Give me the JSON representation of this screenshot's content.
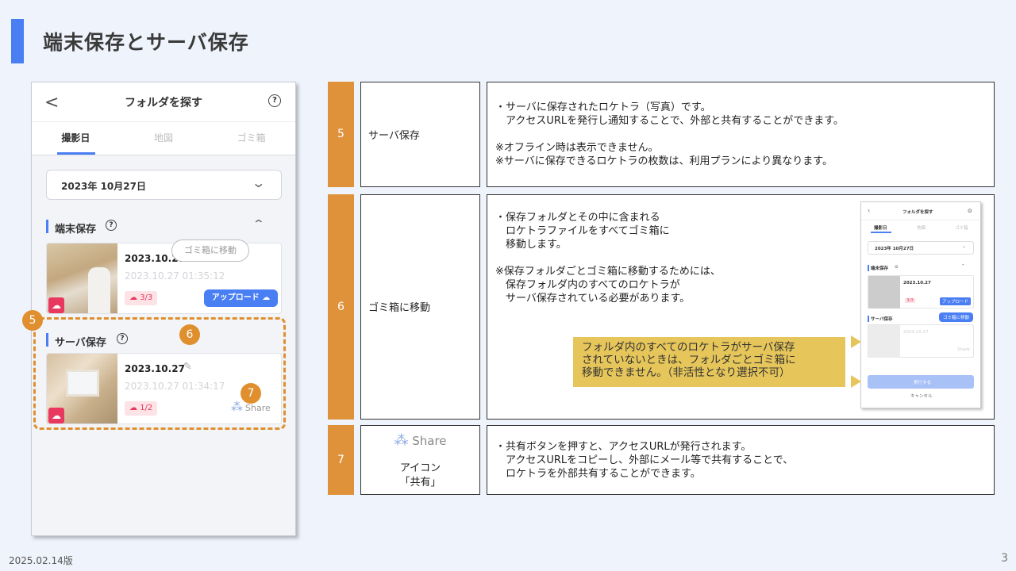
{
  "title": "端末保存とサーバ保存",
  "phone": {
    "back": "<",
    "title": "フォルダを探す",
    "help": "?",
    "tabs": [
      "撮影日",
      "地図",
      "ゴミ箱"
    ],
    "date": "2023年 10月27日",
    "local_section": "端末保存",
    "server_section": "サーバ保存",
    "card1": {
      "date": "2023.10.27",
      "time": "2023.10.27 01:35:12",
      "count": "3/3",
      "upload": "アップロード"
    },
    "card2": {
      "date": "2023.10.27",
      "time": "2023.10.27 01:34:17",
      "count": "1/2",
      "share": "Share"
    },
    "trash_button": "ゴミ箱に移動",
    "badges": [
      "5",
      "6",
      "7"
    ]
  },
  "rows": [
    {
      "num": "5",
      "label": "サーバ保存",
      "desc": "・サーバに保存されたロケトラ（写真）です。\n　アクセスURLを発行し通知することで、外部と共有することができます。\n\n※オフライン時は表示できません。\n※サーバに保存できるロケトラの枚数は、利用プランにより異なります。"
    },
    {
      "num": "6",
      "label": "ゴミ箱に移動",
      "desc": "・保存フォルダとその中に含まれる\n　ロケトラファイルをすべてゴミ箱に\n　移動します。\n\n※保存フォルダごとゴミ箱に移動するためには、\n　保存フォルダ内のすべてのロケトラが\n　サーバ保存されている必要があります。",
      "callout": "フォルダ内のすべてのロケトラがサーバ保存\nされていないときは、フォルダごとゴミ箱に\n移動できません。（非活性となり選択不可）"
    },
    {
      "num": "7",
      "label_share": "Share",
      "label_icon": "アイコン",
      "label_kyoyu": "「共有」",
      "desc": "・共有ボタンを押すと、アクセスURLが発行されます。\n　アクセスURLをコピーし、外部にメール等で共有することで、\n　ロケトラを外部共有することができます。"
    }
  ],
  "mini": {
    "title": "フォルダを探す",
    "tab": "撮影日",
    "tab2": "地図",
    "tab3": "ゴミ箱",
    "date": "2023年 10月27日",
    "local": "端末保存",
    "card_date": "2023.10.27",
    "count": "3/3",
    "upload": "アップロード",
    "server": "サーバ保存",
    "trash": "ゴミ箱に移動",
    "card2_date": "2023.10.27",
    "share": "Share",
    "execute": "実行する",
    "cancel": "キャンセル"
  },
  "footer": {
    "version": "2025.02.14版",
    "page": "3"
  },
  "colors": {
    "accent": "#4a7ef3",
    "orange": "#e0923b",
    "callout": "#e6c65a",
    "pink": "#e8385f"
  }
}
